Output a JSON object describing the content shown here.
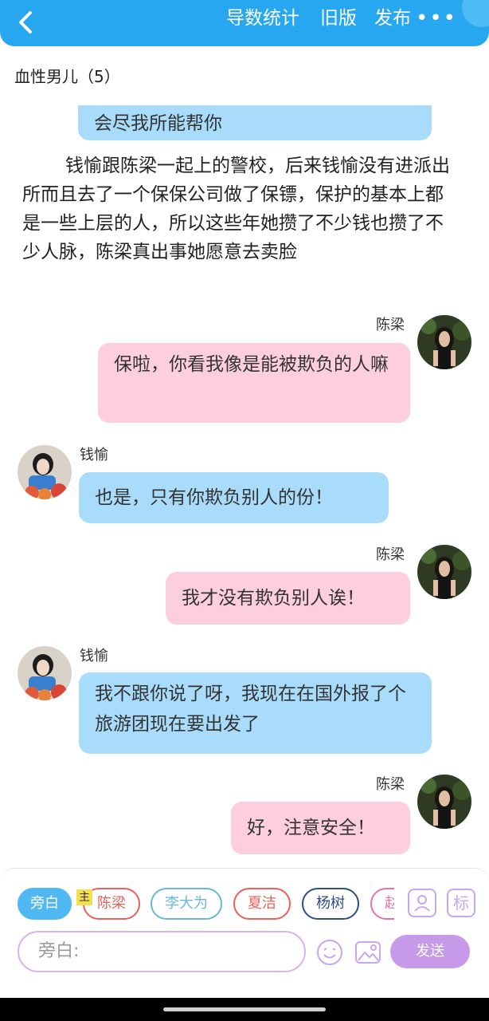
{
  "header": {
    "actions": [
      "导数统计",
      "旧版",
      "发布"
    ],
    "more": "•••"
  },
  "subtitle": "血性男儿（5）",
  "partial_bubble": "会尽我所能帮你",
  "narration": "钱愉跟陈梁一起上的警校，后来钱愉没有进派出所而且去了一个保保公司做了保镖，保护的基本上都是一些上层的人，所以这些年她攒了不少钱也攒了不少人脉，陈梁真出事她愿意去卖脸",
  "messages": [
    {
      "sender": "陈梁",
      "text": "保啦，你看我像是能被欺负的人嘛"
    },
    {
      "sender": "钱愉",
      "text": "也是，只有你欺负别人的份！"
    },
    {
      "sender": "陈梁",
      "text": "我才没有欺负别人诶！"
    },
    {
      "sender": "钱愉",
      "text": "我不跟你说了呀，我现在在国外报了个旅游团现在要出发了"
    },
    {
      "sender": "陈梁",
      "text": "好，注意安全！"
    }
  ],
  "roles": [
    {
      "label": "旁白",
      "color": "#4fb8f2",
      "filled": true
    },
    {
      "label": "陈梁",
      "color": "#e9615a",
      "filled": false
    },
    {
      "label": "李大为",
      "color": "#6ab7d8",
      "filled": false
    },
    {
      "label": "夏洁",
      "color": "#e9615a",
      "filled": false
    },
    {
      "label": "杨树",
      "color": "#2f4f8a",
      "filled": false
    },
    {
      "label": "赵",
      "color": "#e774a4",
      "filled": false
    }
  ],
  "role_badge": "主",
  "tool_icons": [
    "person-card-icon",
    "tag-icon"
  ],
  "tag_icon_text": "标",
  "input": {
    "placeholder": "旁白:"
  },
  "send_label": "发送",
  "colors": {
    "accent": "#27a7f0",
    "blue_bubble": "#a9dcfa",
    "pink_bubble": "#fdcfdc",
    "send": "#c79ae9"
  }
}
